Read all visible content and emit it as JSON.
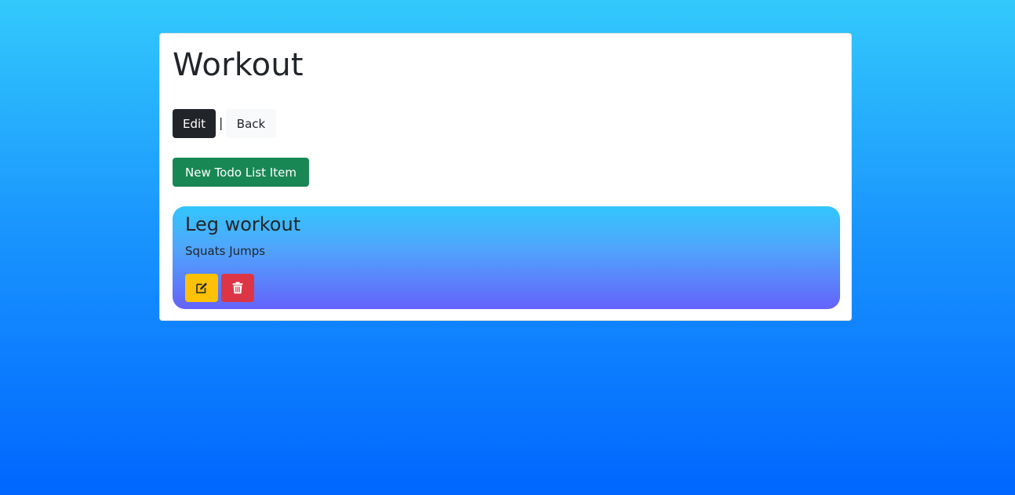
{
  "page": {
    "title": "Workout"
  },
  "actions": {
    "edit_label": "Edit",
    "separator": "|",
    "back_label": "Back",
    "new_item_label": "New Todo List Item"
  },
  "items": [
    {
      "title": "Leg workout",
      "description": "Squats Jumps",
      "edit_icon": "pencil-square-icon",
      "delete_icon": "trash-icon"
    }
  ],
  "colors": {
    "edit_button": "#212529",
    "back_button": "#f8f9fa",
    "new_button": "#198754",
    "item_edit_button": "#ffc107",
    "item_delete_button": "#dc3545"
  }
}
